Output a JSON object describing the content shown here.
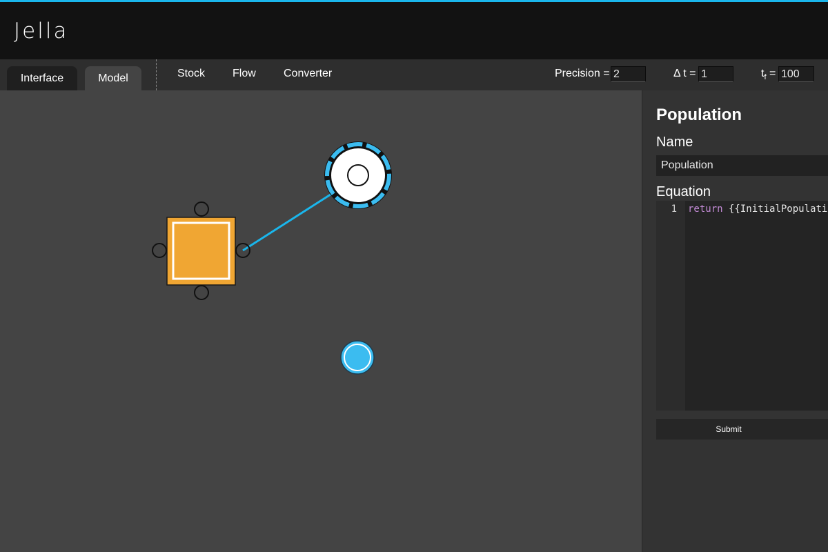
{
  "app": {
    "title": "Jella"
  },
  "tabs": [
    {
      "label": "Interface",
      "active": false
    },
    {
      "label": "Model",
      "active": true
    }
  ],
  "tools": [
    {
      "label": "Stock"
    },
    {
      "label": "Flow"
    },
    {
      "label": "Converter"
    }
  ],
  "params": {
    "precision_label": "Precision =",
    "precision_value": "2",
    "dt_label": "Δ t =",
    "dt_value": "1",
    "tf_label_main": "t",
    "tf_label_sub": "f",
    "tf_label_eq": "=",
    "tf_value": "100"
  },
  "panel": {
    "title": "Population",
    "name_label": "Name",
    "name_value": "Population",
    "equation_label": "Equation",
    "line_number": "1",
    "code_keyword": "return",
    "code_rest": " {{InitialPopulation}}",
    "submit_label": "Submit"
  },
  "colors": {
    "accent": "#1ab6ec",
    "stock_fill": "#f0a633",
    "converter_fill": "#3bbcf0",
    "canvas_bg": "#444444",
    "header_bg": "#121212",
    "panel_bg": "#333333"
  },
  "model": {
    "stock": {
      "selected": true
    },
    "flow": {
      "selected": false
    },
    "converter": {
      "selected": false
    }
  }
}
